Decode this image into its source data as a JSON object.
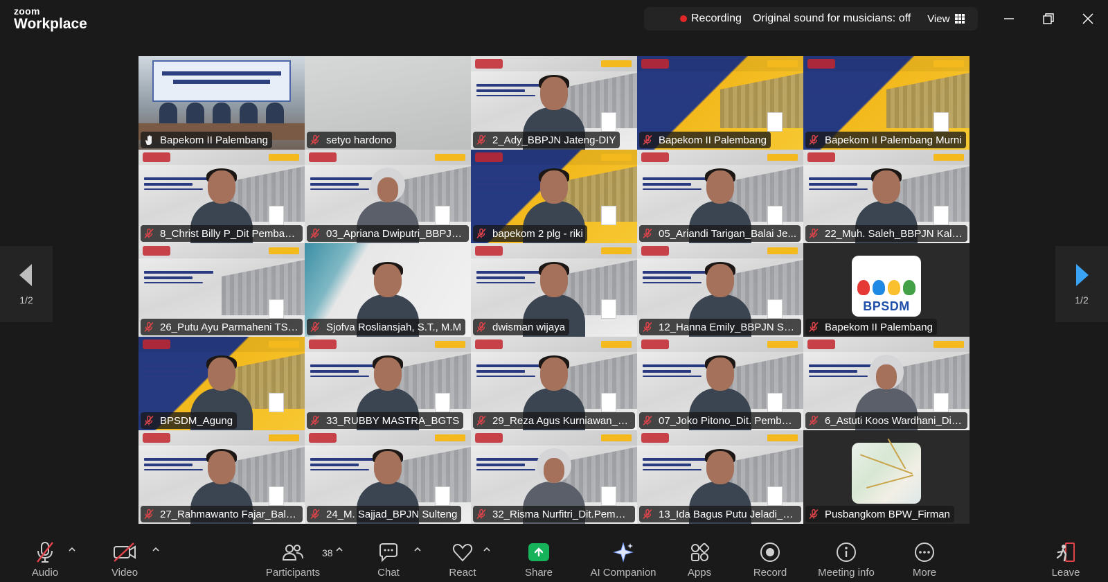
{
  "app": {
    "brand": "zoom",
    "product": "Workplace"
  },
  "status": {
    "recording_label": "Recording",
    "sound_label": "Original sound for musicians: off",
    "view_label": "View",
    "shield_color": "#1fbe5c"
  },
  "pager": {
    "left_label": "1/2",
    "right_label": "1/2"
  },
  "participants": [
    {
      "name": "Bapekom II Palembang",
      "bg": "room",
      "active": true,
      "person": false,
      "icon": "raised-hand-icon"
    },
    {
      "name": "setyo hardono",
      "bg": "camera",
      "person": false,
      "icon": "mic-muted-icon"
    },
    {
      "name": "2_Ady_BBPJN Jateng-DIY",
      "bg": "white",
      "person": true,
      "icon": "mic-muted-icon"
    },
    {
      "name": "Bapekom II Palembang",
      "bg": "yellow",
      "person": false,
      "icon": "mic-muted-icon"
    },
    {
      "name": "Bapekom II Palembang Murni",
      "bg": "yellow",
      "person": false,
      "icon": "mic-muted-icon"
    },
    {
      "name": "8_Christ Billy P_Dit Pembang...",
      "bg": "white",
      "person": true,
      "icon": "mic-muted-icon"
    },
    {
      "name": "03_Apriana Dwiputri_BBPJN ...",
      "bg": "white",
      "person": true,
      "hijab": true,
      "icon": "mic-muted-icon"
    },
    {
      "name": "bapekom 2 plg - riki",
      "bg": "yellow",
      "person": true,
      "icon": "mic-muted-icon"
    },
    {
      "name": "05_Ariandi Tarigan_Balai Je...",
      "bg": "white",
      "person": true,
      "icon": "mic-muted-icon"
    },
    {
      "name": "22_Muh. Saleh_BBPJN Kaltim",
      "bg": "white",
      "person": true,
      "icon": "mic-muted-icon"
    },
    {
      "name": "26_Putu Ayu Parmaheni TS_...",
      "bg": "white",
      "person": false,
      "icon": "mic-muted-icon"
    },
    {
      "name": "Sjofva Rosliansjah, S.T., M.M",
      "bg": "batik",
      "person": true,
      "icon": "mic-muted-icon"
    },
    {
      "name": "dwisman wijaya",
      "bg": "white",
      "person": true,
      "icon": "mic-muted-icon"
    },
    {
      "name": "12_Hanna Emily_BBPJN Sum...",
      "bg": "white",
      "person": true,
      "icon": "mic-muted-icon"
    },
    {
      "name": "Bapekom II Palembang",
      "bg": "dark",
      "logo": "bpsdm",
      "person": false,
      "icon": "mic-muted-icon"
    },
    {
      "name": "BPSDM_Agung",
      "bg": "yellow",
      "person": true,
      "icon": "mic-muted-icon"
    },
    {
      "name": "33_RUBBY MASTRA_BGTS",
      "bg": "white",
      "person": true,
      "icon": "mic-muted-icon"
    },
    {
      "name": "29_Reza Agus Kurniawan_BP...",
      "bg": "white",
      "person": true,
      "icon": "mic-muted-icon"
    },
    {
      "name": "07_Joko Pitono_Dit. Pemban...",
      "bg": "white",
      "person": true,
      "icon": "mic-muted-icon"
    },
    {
      "name": "6_Astuti Koos Wardhani_Dit....",
      "bg": "white",
      "person": true,
      "hijab": true,
      "icon": "mic-muted-icon"
    },
    {
      "name": "27_Rahmawanto Fajar_Balai ...",
      "bg": "white",
      "person": true,
      "icon": "mic-muted-icon"
    },
    {
      "name": "24_M. Sajjad_BPJN Sulteng",
      "bg": "white",
      "person": true,
      "icon": "mic-muted-icon"
    },
    {
      "name": "32_Risma Nurfitri_Dit.Pemb.J...",
      "bg": "white",
      "person": true,
      "hijab": true,
      "icon": "mic-muted-icon"
    },
    {
      "name": "13_Ida Bagus Putu Jeladi_BB...",
      "bg": "white",
      "person": true,
      "icon": "mic-muted-icon"
    },
    {
      "name": "Pusbangkom BPW_Firman",
      "bg": "dark",
      "logo": "map",
      "person": false,
      "icon": "mic-muted-icon"
    }
  ],
  "bpsdm_logo_text": "BPSDM",
  "toolbar": {
    "audio": "Audio",
    "video": "Video",
    "participants": "Participants",
    "participants_count": "38",
    "chat": "Chat",
    "react": "React",
    "share": "Share",
    "ai_companion": "AI Companion",
    "apps": "Apps",
    "record": "Record",
    "meeting_info": "Meeting info",
    "more": "More",
    "leave": "Leave"
  },
  "colors": {
    "active_speaker": "#2fd67b",
    "share_green": "#16b35a",
    "muted_red": "#e0444a",
    "leave_red": "#e0444a"
  }
}
